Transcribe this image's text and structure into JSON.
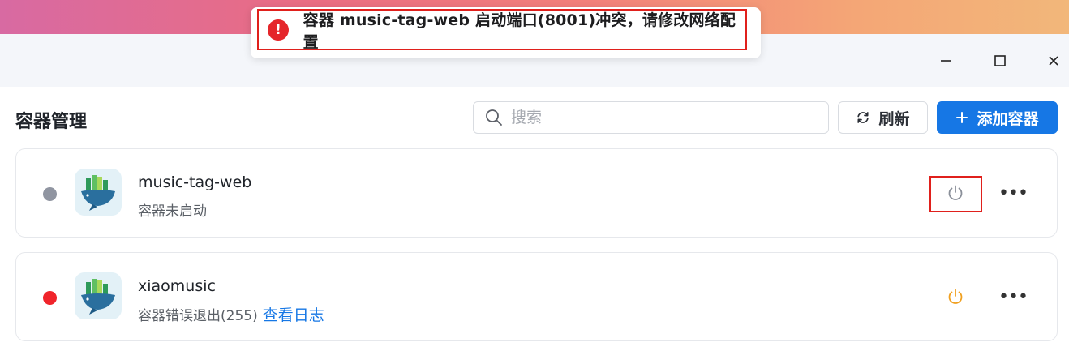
{
  "toast": {
    "message": "容器 music-tag-web 启动端口(8001)冲突，请修改网络配置"
  },
  "window": {
    "minimize_icon": "minimize-icon",
    "maximize_icon": "maximize-icon",
    "close_icon": "close-icon"
  },
  "header": {
    "title": "容器管理",
    "search_placeholder": "搜索",
    "refresh_label": "刷新",
    "add_label": "添加容器"
  },
  "containers": [
    {
      "name": "music-tag-web",
      "status": "容器未启动",
      "status_color": "#9095a1",
      "power_color": "#8a8f99",
      "highlighted": true
    },
    {
      "name": "xiaomusic",
      "status": "容器错误退出(255)",
      "log_link": "查看日志",
      "status_color": "#f0242b",
      "power_color": "#f0a020",
      "highlighted": false
    }
  ],
  "colors": {
    "accent": "#1677e5",
    "error": "#e0201c"
  }
}
